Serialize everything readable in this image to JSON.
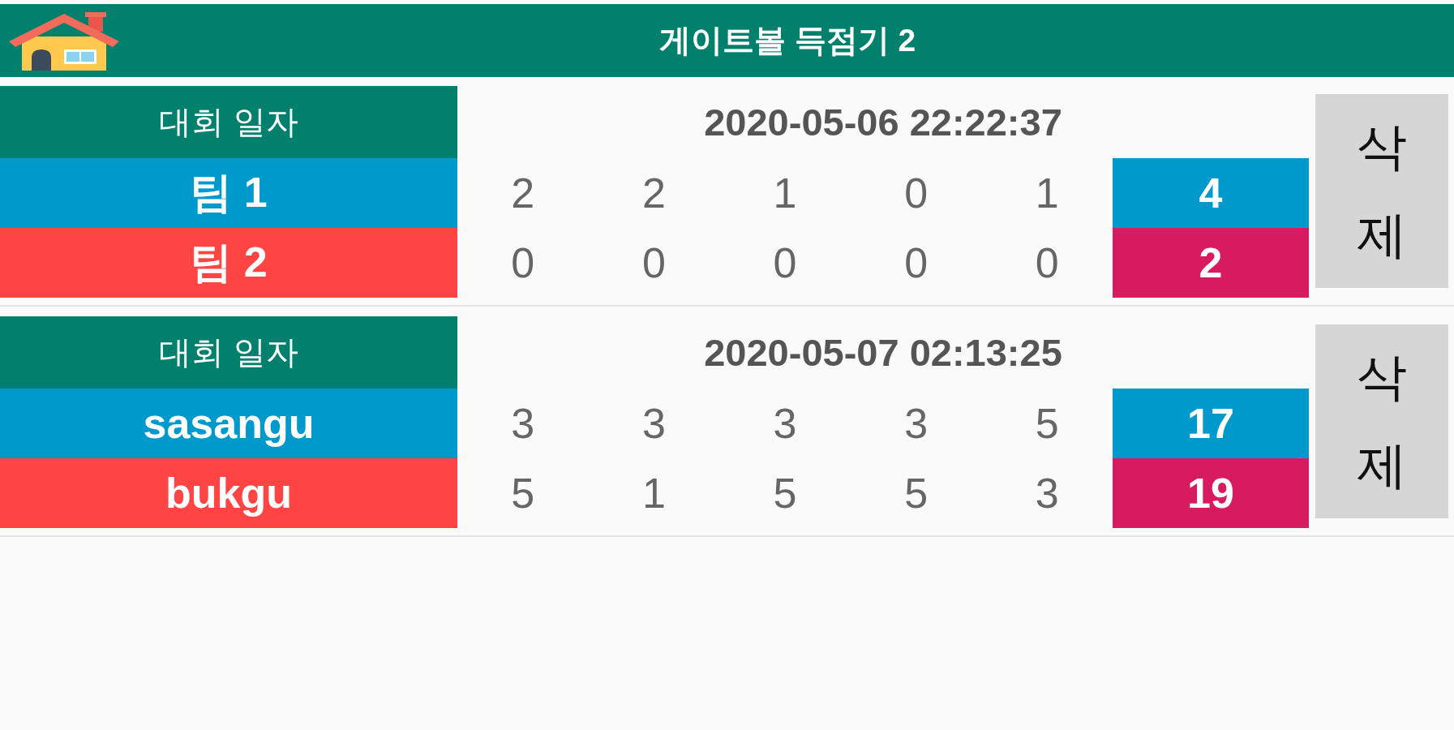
{
  "app_bar": {
    "title": "게이트볼 득점기 2"
  },
  "games": [
    {
      "date_label": "대회 일자",
      "date": "2020-05-06 22:22:37",
      "teams": [
        {
          "name": "팀 1",
          "color": "#0099cc",
          "scores": [
            "2",
            "2",
            "1",
            "0",
            "1"
          ],
          "total": {
            "score": "4",
            "color": "#0099cc"
          }
        },
        {
          "name": "팀 2",
          "color": "#ff4444",
          "scores": [
            "0",
            "0",
            "0",
            "0",
            "0"
          ],
          "total": {
            "score": "2",
            "color": "#d81b60"
          }
        }
      ],
      "delete_button": {
        "label": "삭제"
      }
    },
    {
      "date_label": "대회 일자",
      "date": "2020-05-07 02:13:25",
      "teams": [
        {
          "name": "sasangu",
          "color": "#0099cc",
          "scores": [
            "3",
            "3",
            "3",
            "3",
            "5"
          ],
          "total": {
            "score": "17",
            "color": "#0099cc"
          }
        },
        {
          "name": "bukgu",
          "color": "#ff4444",
          "scores": [
            "5",
            "1",
            "5",
            "5",
            "3"
          ],
          "total": {
            "score": "19",
            "color": "#d81b60"
          }
        }
      ],
      "delete_button": {
        "label": "삭제"
      }
    }
  ]
}
